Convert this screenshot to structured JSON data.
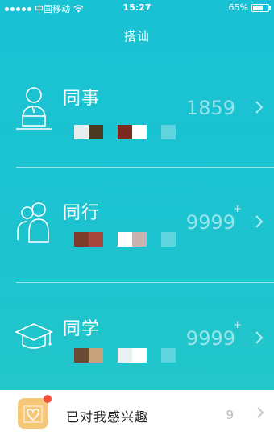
{
  "status_bar": {
    "carrier": "中国移动",
    "time": "15:27",
    "battery_percent": "65%",
    "battery_level": 0.65
  },
  "nav": {
    "title": "搭讪"
  },
  "rows": [
    {
      "label": "同事",
      "count": "1859",
      "plus": "",
      "icon": "colleague-icon",
      "swatches": [
        "#e7ecef",
        "#4b3a22",
        null,
        "#7a2a1f",
        "#ffffff",
        null,
        "#5fd4dd"
      ]
    },
    {
      "label": "同行",
      "count": "9999",
      "plus": "+",
      "icon": "peers-icon",
      "swatches": [
        "#7d3b2a",
        "#a8453d",
        null,
        "#ffffff",
        "#c9b3b0",
        null,
        "#5fd4dd"
      ]
    },
    {
      "label": "同学",
      "count": "9999",
      "plus": "+",
      "icon": "graduation-cap-icon",
      "swatches": [
        "#6b4a33",
        "#c8a27b",
        null,
        "#e7f0f2",
        "#ffffff",
        null,
        "#5fd4dd"
      ]
    }
  ],
  "bottom": {
    "label": "已对我感兴趣",
    "count": "9",
    "icon": "heart-icon",
    "colors": {
      "icon_bg": "#f5c778",
      "badge": "#f04f3b"
    }
  },
  "colors": {
    "background_top": "#19c1d4",
    "background_bottom": "#24c8c9",
    "text": "#ffffff"
  }
}
